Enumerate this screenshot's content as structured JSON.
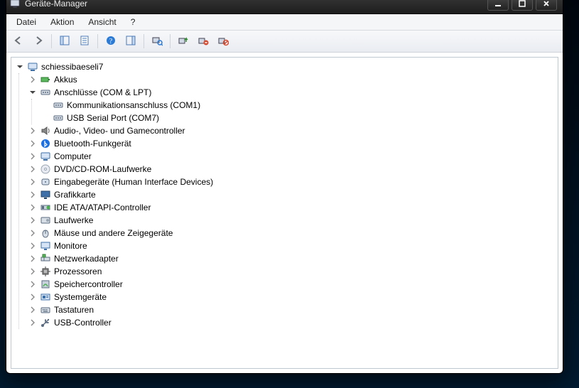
{
  "window": {
    "title": "Geräte-Manager"
  },
  "menu": {
    "file": "Datei",
    "action": "Aktion",
    "view": "Ansicht",
    "help": "?"
  },
  "tree": {
    "root": {
      "label": "schiessibaeseli7",
      "expanded": true,
      "icon": "computer",
      "children": [
        {
          "label": "Akkus",
          "icon": "battery",
          "expanded": false,
          "hasChildren": true
        },
        {
          "label": "Anschlüsse (COM & LPT)",
          "icon": "port",
          "expanded": true,
          "hasChildren": true,
          "children": [
            {
              "label": "Kommunikationsanschluss (COM1)",
              "icon": "port",
              "hasChildren": false
            },
            {
              "label": "USB Serial Port (COM7)",
              "icon": "port",
              "hasChildren": false
            }
          ]
        },
        {
          "label": "Audio-, Video- und Gamecontroller",
          "icon": "audio",
          "expanded": false,
          "hasChildren": true
        },
        {
          "label": "Bluetooth-Funkgerät",
          "icon": "bluetooth",
          "expanded": false,
          "hasChildren": true
        },
        {
          "label": "Computer",
          "icon": "computer",
          "expanded": false,
          "hasChildren": true
        },
        {
          "label": "DVD/CD-ROM-Laufwerke",
          "icon": "disc",
          "expanded": false,
          "hasChildren": true
        },
        {
          "label": "Eingabegeräte (Human Interface Devices)",
          "icon": "hid",
          "expanded": false,
          "hasChildren": true
        },
        {
          "label": "Grafikkarte",
          "icon": "display",
          "expanded": false,
          "hasChildren": true
        },
        {
          "label": "IDE ATA/ATAPI-Controller",
          "icon": "ide",
          "expanded": false,
          "hasChildren": true
        },
        {
          "label": "Laufwerke",
          "icon": "drive",
          "expanded": false,
          "hasChildren": true
        },
        {
          "label": "Mäuse und andere Zeigegeräte",
          "icon": "mouse",
          "expanded": false,
          "hasChildren": true
        },
        {
          "label": "Monitore",
          "icon": "monitor",
          "expanded": false,
          "hasChildren": true
        },
        {
          "label": "Netzwerkadapter",
          "icon": "network",
          "expanded": false,
          "hasChildren": true
        },
        {
          "label": "Prozessoren",
          "icon": "cpu",
          "expanded": false,
          "hasChildren": true
        },
        {
          "label": "Speichercontroller",
          "icon": "storage",
          "expanded": false,
          "hasChildren": true
        },
        {
          "label": "Systemgeräte",
          "icon": "system",
          "expanded": false,
          "hasChildren": true
        },
        {
          "label": "Tastaturen",
          "icon": "keyboard",
          "expanded": false,
          "hasChildren": true
        },
        {
          "label": "USB-Controller",
          "icon": "usb",
          "expanded": false,
          "hasChildren": true
        }
      ]
    }
  }
}
